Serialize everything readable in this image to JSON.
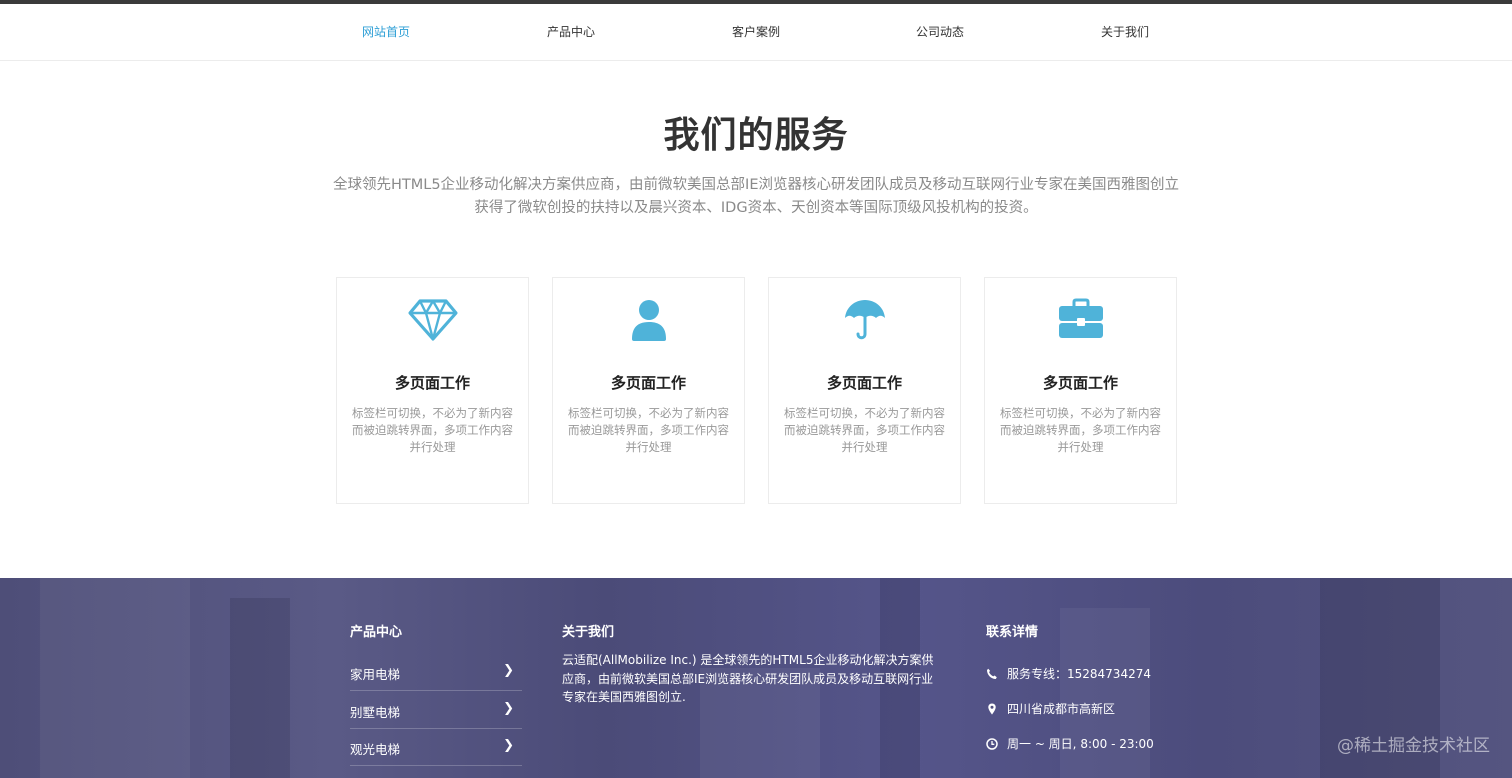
{
  "nav": {
    "items": [
      {
        "label": "网站首页",
        "active": true
      },
      {
        "label": "产品中心",
        "active": false
      },
      {
        "label": "客户案例",
        "active": false
      },
      {
        "label": "公司动态",
        "active": false
      },
      {
        "label": "关于我们",
        "active": false
      }
    ]
  },
  "services": {
    "title": "我们的服务",
    "intro_line1": "全球领先HTML5企业移动化解决方案供应商，由前微软美国总部IE浏览器核心研发团队成员及移动互联网行业专家在美国西雅图创立",
    "intro_line2": "获得了微软创投的扶持以及晨兴资本、IDG资本、天创资本等国际顶级风投机构的投资。",
    "cards": [
      {
        "icon": "diamond-icon",
        "title": "多页面工作",
        "desc": "标签栏可切换，不必为了新内容而被迫跳转界面，多项工作内容并行处理"
      },
      {
        "icon": "user-icon",
        "title": "多页面工作",
        "desc": "标签栏可切换，不必为了新内容而被迫跳转界面，多项工作内容并行处理"
      },
      {
        "icon": "umbrella-icon",
        "title": "多页面工作",
        "desc": "标签栏可切换，不必为了新内容而被迫跳转界面，多项工作内容并行处理"
      },
      {
        "icon": "briefcase-icon",
        "title": "多页面工作",
        "desc": "标签栏可切换，不必为了新内容而被迫跳转界面，多项工作内容并行处理"
      }
    ]
  },
  "footer": {
    "products": {
      "heading": "产品中心",
      "links": [
        {
          "label": "家用电梯",
          "icon": "chevron-right-icon"
        },
        {
          "label": "别墅电梯",
          "icon": "chevron-right-icon"
        },
        {
          "label": "观光电梯",
          "icon": "chevron-right-icon"
        }
      ]
    },
    "about": {
      "heading": "关于我们",
      "text": "云适配(AllMobilize Inc.) 是全球领先的HTML5企业移动化解决方案供应商，由前微软美国总部IE浏览器核心研发团队成员及移动互联网行业专家在美国西雅图创立."
    },
    "contact": {
      "heading": "联系详情",
      "phone": "服务专线：15284734274",
      "address": "四川省成都市高新区",
      "hours": "周一 ~ 周日, 8:00 - 23:00"
    }
  },
  "watermark": "@稀土掘金技术社区",
  "colors": {
    "accent": "#2e9fd6",
    "icon": "#4fb3d9",
    "footer_bg": "#50507e"
  }
}
